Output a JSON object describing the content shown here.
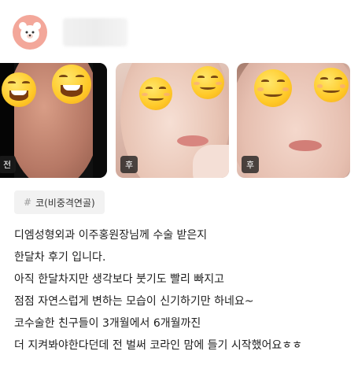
{
  "post": {
    "author": {
      "avatar_icon": "bear-face-icon",
      "avatar_bg": "#f3a79a"
    },
    "photos": [
      {
        "badge": "전"
      },
      {
        "badge": "후"
      },
      {
        "badge": "후"
      }
    ],
    "tag": {
      "hash": "#",
      "label": "코(비중격연골)"
    },
    "body_lines": [
      "디엠성형외과 이주홍원장님께 수술 받은지",
      "한달차 후기 입니다.",
      "아직 한달차지만 생각보다 붓기도 빨리 빠지고",
      "점점 자연스럽게 변하는 모습이 신기하기만 하네요~",
      "코수술한 친구들이 3개월에서 6개월까진",
      "더 지켜봐야한다던데 전 벌써 코라인 맘에 들기 시작했어요ㅎㅎ"
    ]
  }
}
